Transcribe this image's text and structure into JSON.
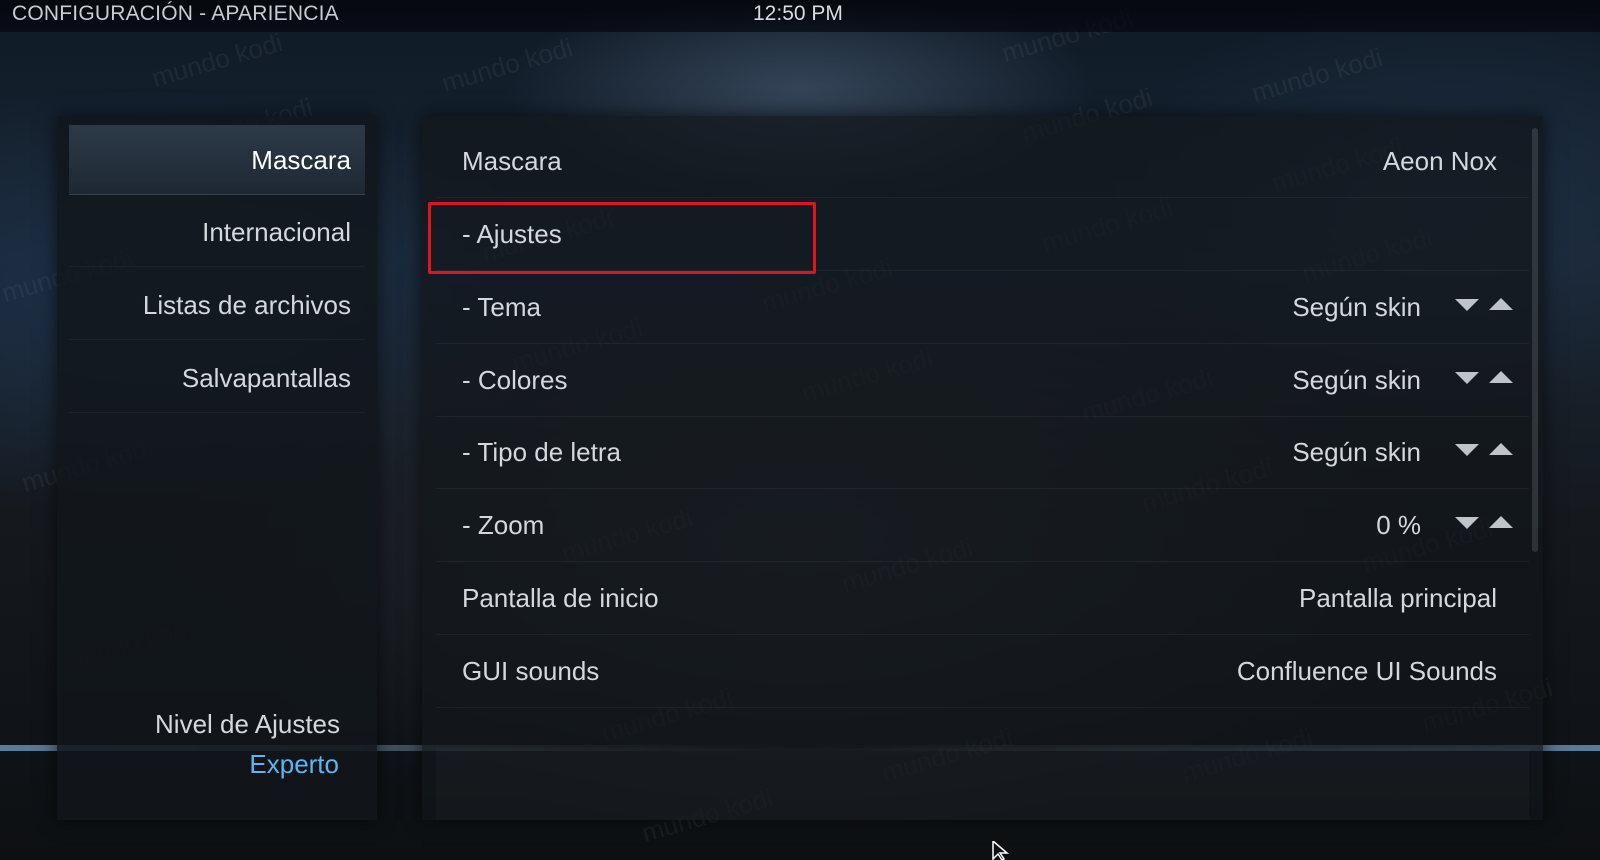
{
  "window": {
    "title": "CONFIGURACIÓN - APARIENCIA",
    "clock": "12:50 PM"
  },
  "watermark": "mundo kodi",
  "sidebar": {
    "items": [
      {
        "label": "Mascara",
        "active": true
      },
      {
        "label": "Internacional",
        "active": false
      },
      {
        "label": "Listas de archivos",
        "active": false
      },
      {
        "label": "Salvapantallas",
        "active": false
      }
    ],
    "level_label": "Nivel de Ajustes",
    "level_value": "Experto"
  },
  "settings": {
    "rows": [
      {
        "label": "Mascara",
        "value": "Aeon Nox"
      },
      {
        "label": "- Ajustes",
        "value": ""
      },
      {
        "label": "- Tema",
        "value": "Según skin"
      },
      {
        "label": "- Colores",
        "value": "Según skin"
      },
      {
        "label": "- Tipo de letra",
        "value": "Según skin"
      },
      {
        "label": "- Zoom",
        "value": "0 %"
      },
      {
        "label": "Pantalla de inicio",
        "value": "Pantalla principal"
      },
      {
        "label": "GUI sounds",
        "value": "Confluence UI Sounds"
      }
    ]
  },
  "colors": {
    "accent": "#5fb3ee",
    "highlight_box": "#e0141e",
    "active_item": "#2c3a48"
  }
}
